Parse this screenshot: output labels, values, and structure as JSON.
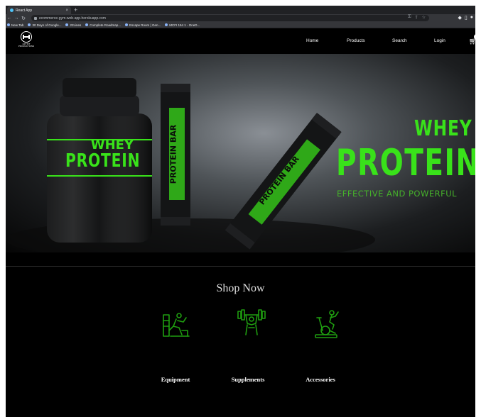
{
  "browser": {
    "tab_title": "React App",
    "tab_close": "×",
    "new_tab": "+",
    "url": "ecommerce-gym-web-app.herokuapp.com",
    "bookmarks": [
      "New Tab",
      "30 Days of Google...",
      "22Lines",
      "Complete Roadmap...",
      "Escape Room | Gen...",
      "MCFI 154 1 - OneD..."
    ]
  },
  "header": {
    "logo_text": "LIFTKIT\nPRODUCTIONS",
    "nav": {
      "home": "Home",
      "products": "Products",
      "search": "Search",
      "login": "Login"
    },
    "cart_icon": "cart-icon",
    "user_icon": "user-circle-icon"
  },
  "hero": {
    "headline_top": "WHEY",
    "headline_main": "PROTEIN",
    "tagline": "EFFECTIVE AND POWERFUL",
    "jar_label_top": "WHEY",
    "jar_label_main": "PROTEIN",
    "bar_label": "PROTEIN BAR",
    "accent_color": "#39e21a"
  },
  "shop": {
    "title": "Shop Now",
    "categories": [
      {
        "label": "Equipment",
        "icon": "gym-equipment-icon"
      },
      {
        "label": "Supplements",
        "icon": "dumbbell-lifter-icon"
      },
      {
        "label": "Accessories",
        "icon": "exercise-bike-icon"
      }
    ],
    "icon_color": "#1f9e10"
  }
}
